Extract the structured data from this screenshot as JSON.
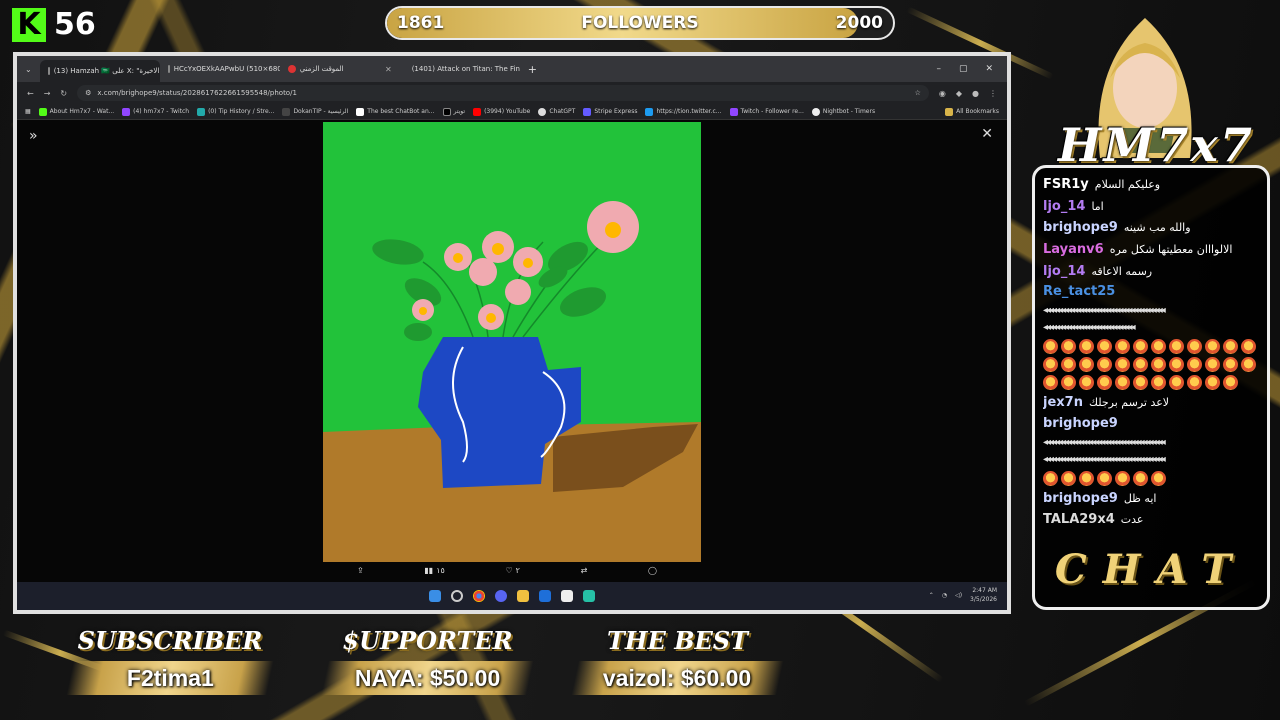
{
  "kick": {
    "logo": "K",
    "viewer_count": "56"
  },
  "followers": {
    "current": "1861",
    "label": "FOLLOWERS",
    "goal": "2000",
    "progress": 0.93
  },
  "browser": {
    "tabs": [
      {
        "label": "(13) Hamzah 🇸🇦 على X: \"الاخيرة\"",
        "icon": "x-icon",
        "active": true
      },
      {
        "label": "HCcYxOEXkAAPwbU (510×680)",
        "icon": "x-icon",
        "active": false
      },
      {
        "label": "الموقت الزمني",
        "icon": "timer-icon",
        "active": false
      },
      {
        "label": "(1401) Attack on Titan: The Fin",
        "icon": "youtube-icon",
        "active": false
      }
    ],
    "new_tab": "+",
    "window_controls": [
      "–",
      "▢",
      "✕"
    ],
    "url": "x.com/brighope9/status/2028617622661595548/photo/1",
    "bookmarks": [
      "About Hm7x7 - Wat...",
      "(4) hm7x7 - Twitch",
      "(0) Tip History / Stre...",
      "DokanTIP - الرئيسية",
      "The best ChatBot an...",
      "تويتر",
      "(3994) YouTube",
      "ChatGPT",
      "Stripe Express",
      "https://tion.twitter.c...",
      "Twitch - Follower re...",
      "Nightbot - Timers"
    ],
    "all_bookmarks": "All Bookmarks"
  },
  "post_actions": {
    "views": "١٥",
    "likes": "٢"
  },
  "taskbar": {
    "time": "2:47 AM",
    "date": "3/5/2026"
  },
  "brand": {
    "logo_text": "HM7x7"
  },
  "chat": {
    "title": "CHAT",
    "messages": [
      {
        "user": "FSR1y",
        "text": "وعليكم السلام",
        "color": "#ffffff"
      },
      {
        "user": "ljo_14",
        "text": "اما",
        "color": "#b37cf2"
      },
      {
        "user": "brighope9",
        "text": "والله مب شينه",
        "color": "#c9d4ff"
      },
      {
        "user": "Layanv6",
        "text": "الالوااان معطيتها شكل مره",
        "color": "#d96ce0"
      },
      {
        "user": "ljo_14",
        "text": "رسمه الاعاقه",
        "color": "#b37cf2"
      },
      {
        "user": "Re_tact25",
        "text": "",
        "color": "#4a90e2"
      },
      {
        "user": "jex7n",
        "text": "لاعد ترسم برجلك",
        "color": "#c9d4ff"
      },
      {
        "user": "brighope9",
        "text": "",
        "color": "#c9d4ff"
      },
      {
        "user": "brighope9",
        "text": "ايه ظل",
        "color": "#c9d4ff"
      },
      {
        "user": "TALA29x4",
        "text": "عدت",
        "color": "#dddddd"
      }
    ]
  },
  "bottom": {
    "subscriber": {
      "title": "SUBSCRIBER",
      "name": "F2tima1"
    },
    "supporter": {
      "title": "$UPPORTER",
      "name": "NAYA: $50.00"
    },
    "best": {
      "title": "THE BEST",
      "name": "vaizol: $60.00"
    }
  }
}
